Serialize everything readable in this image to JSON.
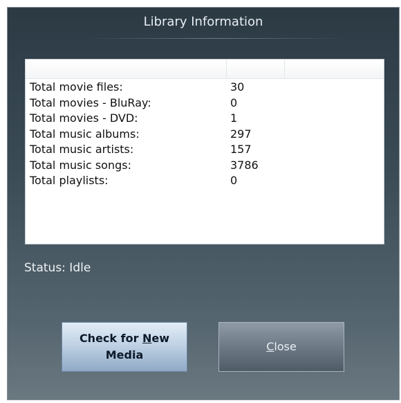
{
  "window": {
    "title": "Library Information"
  },
  "table": {
    "rows": [
      {
        "label": "Total movie files:",
        "value": "30"
      },
      {
        "label": "Total movies - BluRay:",
        "value": "0"
      },
      {
        "label": "Total movies - DVD:",
        "value": "1"
      },
      {
        "label": "Total music albums:",
        "value": "297"
      },
      {
        "label": "Total music artists:",
        "value": "157"
      },
      {
        "label": "Total music songs:",
        "value": "3786"
      },
      {
        "label": "Total playlists:",
        "value": "0"
      }
    ]
  },
  "status": {
    "text": "Status: Idle"
  },
  "buttons": {
    "check_prefix": "Check for ",
    "check_accel": "N",
    "check_rest": "ew",
    "check_line2": "Media",
    "close_accel": "C",
    "close_rest": "lose"
  },
  "colors": {
    "background_top": "#2c3a44",
    "background_bottom": "#6a7880",
    "check_button": "#bccfe2",
    "close_button": "#6d7a86"
  }
}
